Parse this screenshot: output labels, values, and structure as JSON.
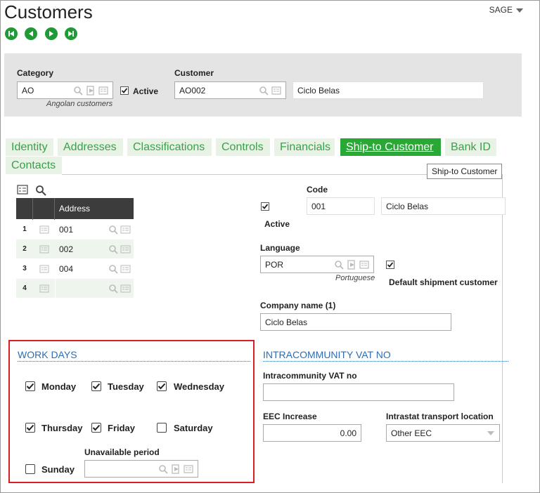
{
  "page": {
    "title": "Customers",
    "user_menu": "SAGE"
  },
  "nav": [
    {
      "name": "first-record-button"
    },
    {
      "name": "previous-record-button"
    },
    {
      "name": "next-record-button"
    },
    {
      "name": "last-record-button"
    }
  ],
  "header": {
    "category_label": "Category",
    "category_value": "AO",
    "category_desc": "Angolan customers",
    "active_label": "Active",
    "active_checked": true,
    "customer_label": "Customer",
    "customer_value": "AO002",
    "customer_name": "Ciclo Belas"
  },
  "tabs": [
    {
      "label": "Identity",
      "active": false
    },
    {
      "label": "Addresses",
      "active": false
    },
    {
      "label": "Classifications",
      "active": false
    },
    {
      "label": "Controls",
      "active": false
    },
    {
      "label": "Financials",
      "active": false
    },
    {
      "label": "Ship-to Customer",
      "active": true
    },
    {
      "label": "Bank ID",
      "active": false
    },
    {
      "label": "Contacts",
      "active": false
    }
  ],
  "tooltip": "Ship-to Customer",
  "grid": {
    "column_header": "Address",
    "rows": [
      {
        "num": "1",
        "value": "001"
      },
      {
        "num": "2",
        "value": "002"
      },
      {
        "num": "3",
        "value": "004"
      },
      {
        "num": "4",
        "value": ""
      }
    ]
  },
  "ship_to": {
    "code_label": "Code",
    "code_value": "001",
    "code_desc": "Ciclo Belas",
    "active_label": "Active",
    "language_label": "Language",
    "language_value": "POR",
    "language_desc": "Portuguese",
    "default_label": "Default shipment customer",
    "company_label": "Company name (1)",
    "company_value": "Ciclo Belas"
  },
  "work_days": {
    "title": "WORK DAYS",
    "days": [
      {
        "label": "Monday",
        "checked": true
      },
      {
        "label": "Tuesday",
        "checked": true
      },
      {
        "label": "Wednesday",
        "checked": true
      },
      {
        "label": "Thursday",
        "checked": true
      },
      {
        "label": "Friday",
        "checked": true
      },
      {
        "label": "Saturday",
        "checked": false
      },
      {
        "label": "Sunday",
        "checked": false
      }
    ],
    "unavailable_label": "Unavailable period",
    "unavailable_value": ""
  },
  "vat": {
    "title": "INTRACOMMUNITY VAT NO",
    "vat_label": "Intracommunity VAT no",
    "vat_value": "",
    "eec_label": "EEC Increase",
    "eec_value": "0.00",
    "intrastat_label": "Intrastat transport location",
    "intrastat_value": "Other EEC"
  },
  "colors": {
    "accent_green": "#2aa836",
    "tab_bg": "#e8f3e6",
    "section_blue": "#2c6eb5",
    "highlight_red": "#d81e24"
  }
}
